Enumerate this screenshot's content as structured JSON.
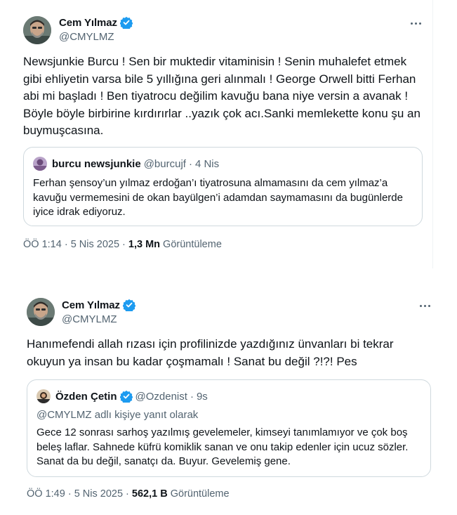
{
  "colors": {
    "text_primary": "#0f1419",
    "text_secondary": "#536471",
    "verified_blue": "#1d9bf0",
    "border": "#cfd9de"
  },
  "tweets": [
    {
      "author": {
        "name": "Cem Yılmaz",
        "handle": "@CMYLMZ",
        "verified_icon": "verified-badge-icon"
      },
      "text": "Newsjunkie Burcu ! Sen bir muktedir vitaminisin ! Senin muhalefet etmek gibi ehliyetin varsa bile 5 yıllığına geri alınmalı ! George Orwell bitti Ferhan abi mi başladı ! Ben tiyatrocu değilim kavuğu bana niye versin a avanak ! Böyle böyle birbirine kırdırırlar ..yazık çok acı.Sanki memlekette konu şu an buymuşcasına.",
      "quote": {
        "name": "burcu newsjunkie",
        "handle": "@burcujf",
        "dot": "·",
        "time": "4 Nis",
        "text": "Ferhan şensoy’un yılmaz erdoğan’ı tiyatrosuna almamasını da cem yılmaz’a kavuğu vermemesini de okan bayülgen’i adamdan saymamasını da bugünlerde iyice idrak ediyoruz."
      },
      "meta": {
        "time": "ÖÖ 1:14 · 5 Nis 2025 · ",
        "views": "1,3 Mn",
        "views_label": " Görüntüleme"
      }
    },
    {
      "author": {
        "name": "Cem Yılmaz",
        "handle": "@CMYLMZ",
        "verified_icon": "verified-badge-icon"
      },
      "text": "Hanımefendi allah rızası için profilinizde yazdığınız ünvanları bi tekrar okuyun ya insan bu kadar çoşmamalı !  Sanat bu değil ?!?! Pes",
      "quote": {
        "name": "Özden Çetin",
        "handle": "@Ozdenist",
        "dot": "·",
        "time": "9s",
        "reply_to": "@CMYLMZ adlı kişiye yanıt olarak",
        "text": "Gece 12 sonrası sarhoş yazılmış gevelemeler, kimseyi tanımlamıyor ve çok boş beleş laflar. Sahnede küfrü komiklik sanan ve onu takip edenler için ucuz sözler. Sanat da bu değil, sanatçı da. Buyur. Gevelemiş gene."
      },
      "meta": {
        "time": "ÖÖ 1:49 · 5 Nis 2025 · ",
        "views": "562,1 B",
        "views_label": " Görüntüleme"
      }
    }
  ]
}
